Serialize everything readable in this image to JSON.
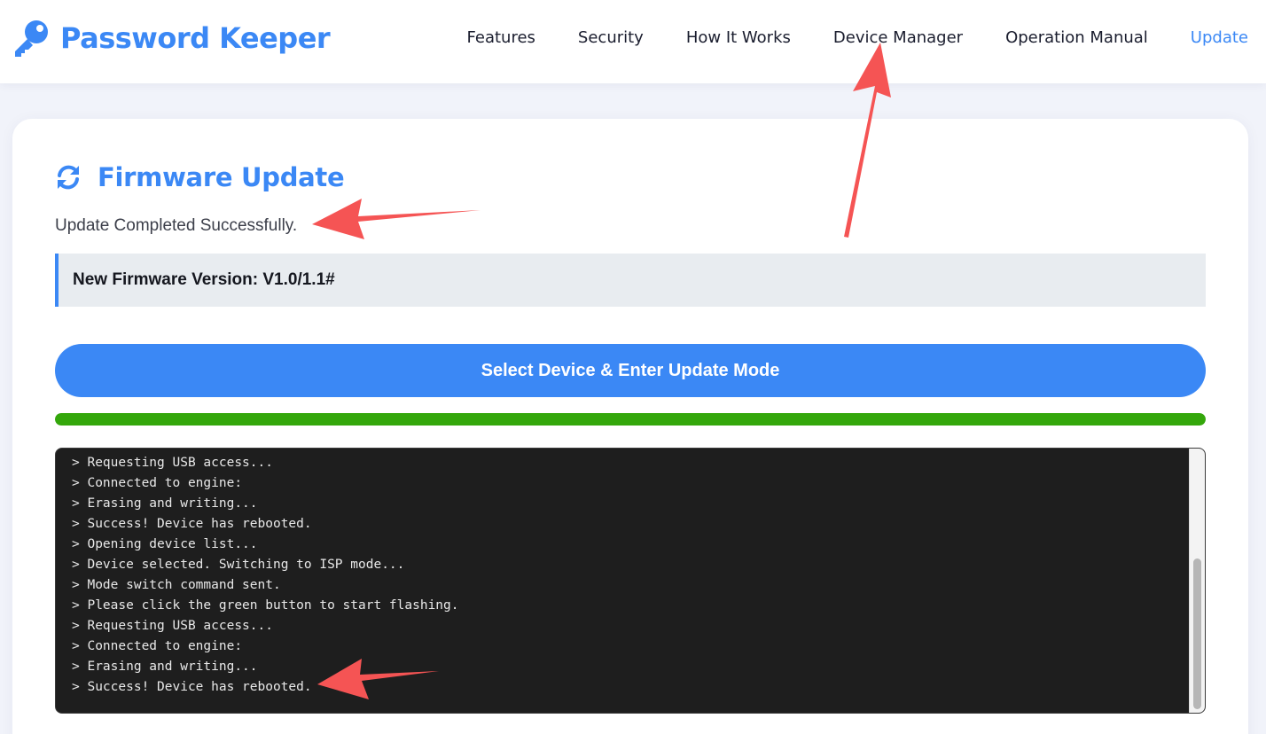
{
  "app": {
    "title": "Password Keeper"
  },
  "nav": {
    "items": [
      {
        "label": "Features",
        "active": false
      },
      {
        "label": "Security",
        "active": false
      },
      {
        "label": "How It Works",
        "active": false
      },
      {
        "label": "Device Manager",
        "active": false
      },
      {
        "label": "Operation Manual",
        "active": false
      },
      {
        "label": "Update",
        "active": true
      }
    ]
  },
  "firmware": {
    "title": "Firmware Update",
    "status": "Update Completed Successfully.",
    "version_text": "New Firmware Version: V1.0/1.1#",
    "action_label": "Select Device & Enter Update Mode",
    "progress": 1.0
  },
  "console": {
    "lines": [
      "> Requesting USB access...",
      "> Connected to engine:",
      "> Erasing and writing...",
      "> Success! Device has rebooted.",
      "> Opening device list...",
      "> Device selected. Switching to ISP mode...",
      "> Mode switch command sent.",
      "> Please click the green button to start flashing.",
      "> Requesting USB access...",
      "> Connected to engine:",
      "> Erasing and writing...",
      "> Success! Device has rebooted."
    ]
  },
  "icons": {
    "brand": "key-icon",
    "title": "refresh-icon",
    "annotation": "red-arrow"
  },
  "colors": {
    "accent": "#3b88f5",
    "progress": "#34a70b",
    "console_bg": "#1e1e1e",
    "annotation": "#f55454"
  }
}
